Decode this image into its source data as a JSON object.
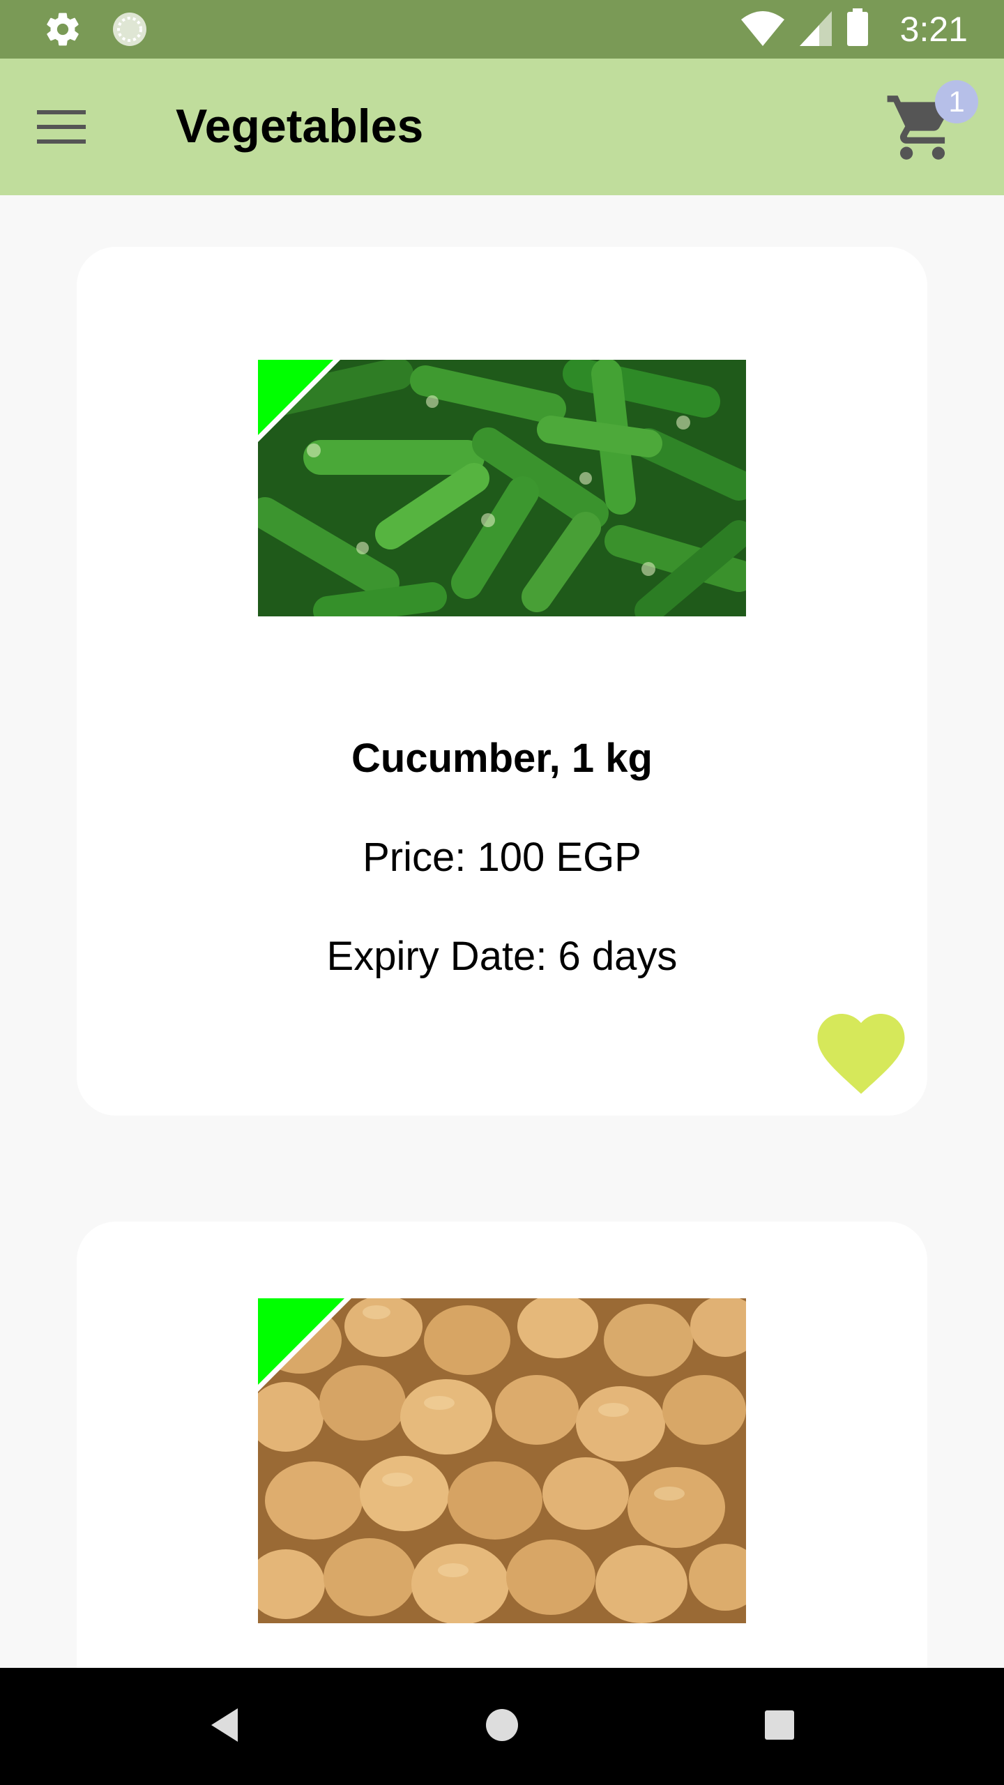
{
  "status_bar": {
    "time": "3:21",
    "icons": [
      "settings-icon",
      "sync-icon",
      "wifi-icon",
      "signal-icon",
      "battery-icon"
    ]
  },
  "app_bar": {
    "title": "Vegetables",
    "menu_icon": "hamburger-menu-icon",
    "cart_icon": "shopping-cart-icon",
    "cart_count": "1"
  },
  "products": [
    {
      "name": "Cucumber, 1 kg",
      "price": "Price: 100 EGP",
      "expiry": "Expiry Date: 6 days",
      "image": "cucumbers-image",
      "favorite_icon": "heart-icon"
    },
    {
      "name": "",
      "price": "",
      "expiry": "",
      "image": "potatoes-image"
    }
  ],
  "nav_bar": {
    "icons": [
      "back-icon",
      "home-icon",
      "recents-icon"
    ]
  },
  "colors": {
    "status_bar": "#7a9a56",
    "app_bar": "#c0dd9c",
    "background": "#f8f8f8",
    "card": "#ffffff",
    "badge": "#b6bfe8",
    "heart": "#d6e85a",
    "corner_tag": "#00ff00"
  }
}
